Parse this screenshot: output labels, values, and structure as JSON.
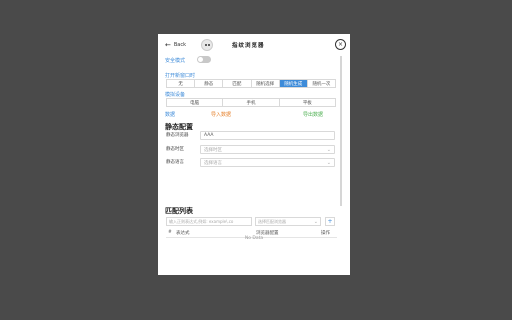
{
  "header": {
    "back_label": "Back",
    "title": "指纹浏览器"
  },
  "safe_mode": {
    "label": "安全模式",
    "enabled": false
  },
  "mode": {
    "label": "打开新窗口时",
    "options": [
      "无",
      "静态",
      "匹配",
      "随机选择",
      "随机生成",
      "随机一次"
    ],
    "selected": "随机生成"
  },
  "device": {
    "label": "模拟设备",
    "options": [
      "电脑",
      "手机",
      "平板"
    ]
  },
  "data_section": {
    "label": "数据",
    "import_label": "导入数据",
    "export_label": "导出数据"
  },
  "static_config": {
    "title": "静态配置",
    "fields": [
      {
        "label": "静态浏览器",
        "value": "AAA",
        "placeholder": ""
      },
      {
        "label": "静态时区",
        "value": "",
        "placeholder": "选择时区"
      },
      {
        "label": "静态语言",
        "value": "",
        "placeholder": "选择语言"
      }
    ]
  },
  "match_list": {
    "title": "匹配列表",
    "input_placeholder": "输入正则表达式,例如: example\\.co",
    "select_placeholder": "选择匹配浏览器",
    "add_label": "+",
    "columns": [
      "#",
      "表达式",
      "浏览器配置",
      "操作"
    ],
    "empty_text": "No Data"
  },
  "colors": {
    "accent": "#3d8bd9",
    "import": "#e6812b",
    "export": "#4caf50",
    "backdrop": "#4a4a4a"
  }
}
